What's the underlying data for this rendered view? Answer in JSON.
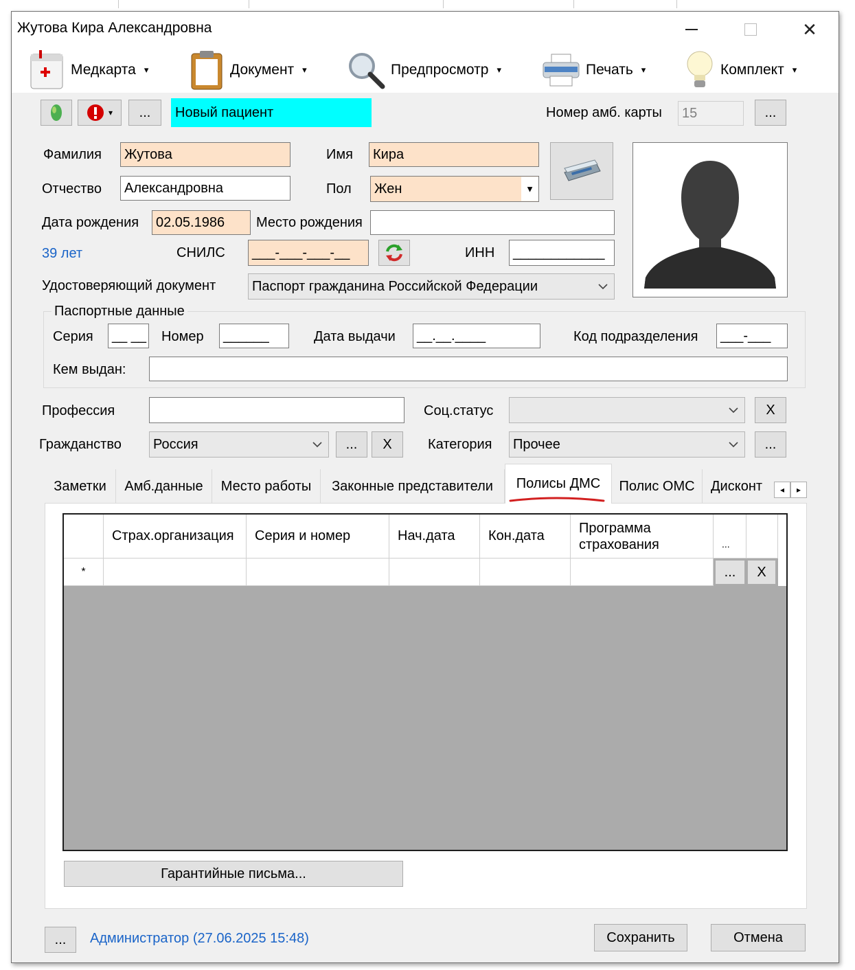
{
  "window": {
    "title": "Жутова Кира Александровна",
    "minimize_glyph": "—",
    "maximize_glyph": "☐",
    "close_glyph": "✕"
  },
  "toolbar": {
    "items": [
      {
        "label": "Медкарта",
        "icon": "medcard-icon"
      },
      {
        "label": "Документ",
        "icon": "clipboard-icon"
      },
      {
        "label": "Предпросмотр",
        "icon": "magnifier-icon"
      },
      {
        "label": "Печать",
        "icon": "printer-icon"
      },
      {
        "label": "Комплект",
        "icon": "lightbulb-icon"
      }
    ],
    "caret": "▾"
  },
  "header": {
    "ellipsis": "...",
    "status": "Новый пациент",
    "card_number_label": "Номер амб. карты",
    "card_number_value": "15"
  },
  "form": {
    "lastname_label": "Фамилия",
    "lastname": "Жутова",
    "firstname_label": "Имя",
    "firstname": "Кира",
    "patronymic_label": "Отчество",
    "patronymic": "Александровна",
    "gender_label": "Пол",
    "gender": "Жен",
    "birthdate_label": "Дата рождения",
    "birthdate": "02.05.1986",
    "birthplace_label": "Место рождения",
    "birthplace": "",
    "age": "39 лет",
    "snils_label": "СНИЛС",
    "snils": "___-___-___-__",
    "inn_label": "ИНН",
    "inn": "____________",
    "id_doc_label": "Удостоверяющий документ",
    "id_doc": "Паспорт гражданина Российской Федерации"
  },
  "passport": {
    "group_label": "Паспортные данные",
    "series_label": "Серия",
    "series": "__ __",
    "number_label": "Номер",
    "number": "______",
    "issue_date_label": "Дата выдачи",
    "issue_date": "__.__.____",
    "dept_code_label": "Код подразделения",
    "dept_code": "___-___",
    "issued_by_label": "Кем выдан:",
    "issued_by": ""
  },
  "extra": {
    "profession_label": "Профессия",
    "profession": "",
    "social_label": "Соц.статус",
    "social": "",
    "citizenship_label": "Гражданство",
    "citizenship": "Россия",
    "category_label": "Категория",
    "category": "Прочее",
    "x_label": "X"
  },
  "tabs": [
    {
      "label": "Заметки"
    },
    {
      "label": "Амб.данные"
    },
    {
      "label": "Место работы"
    },
    {
      "label": "Законные представители"
    },
    {
      "label": "Полисы ДМС"
    },
    {
      "label": "Полис ОМС"
    },
    {
      "label": "Дисконт"
    }
  ],
  "tab_scroll": {
    "left": "◂",
    "right": "▸"
  },
  "grid": {
    "columns": [
      "Страх.организация",
      "Серия и номер",
      "Нач.дата",
      "Кон.дата",
      "Программа страхования",
      "..."
    ],
    "new_row_marker": "*",
    "row_ellipsis": "...",
    "row_delete": "X"
  },
  "guarantee_button": "Гарантийные письма...",
  "footer": {
    "ellipsis": "...",
    "user_stamp": "Администратор (27.06.2025 15:48)",
    "save": "Сохранить",
    "cancel": "Отмена"
  },
  "colors": {
    "status_bg": "#00ffff",
    "required_bg": "#fde2c9",
    "grid_empty_bg": "#ababab",
    "link_blue": "#1a64c8",
    "active_tab_underline": "#d22020"
  }
}
